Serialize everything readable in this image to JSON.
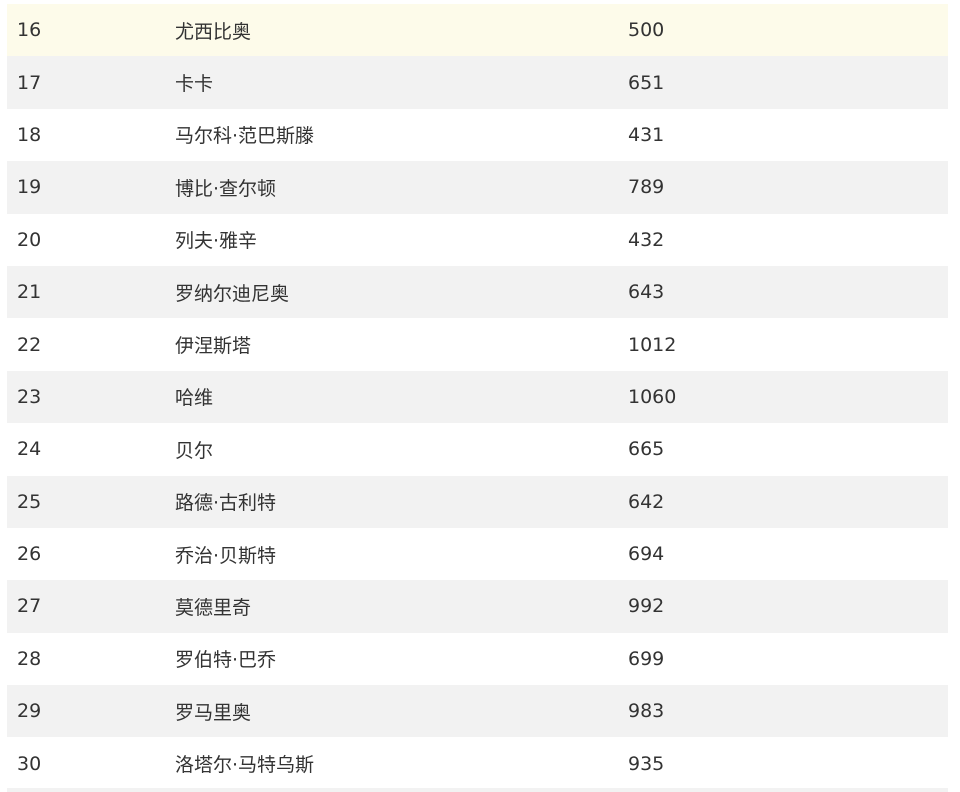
{
  "table": {
    "rows": [
      {
        "rank": "16",
        "name": "尤西比奥",
        "score": "500",
        "highlight": true
      },
      {
        "rank": "17",
        "name": "卡卡",
        "score": "651"
      },
      {
        "rank": "18",
        "name": "马尔科·范巴斯滕",
        "score": "431"
      },
      {
        "rank": "19",
        "name": "博比·查尔顿",
        "score": "789"
      },
      {
        "rank": "20",
        "name": "列夫·雅辛",
        "score": "432"
      },
      {
        "rank": "21",
        "name": "罗纳尔迪尼奥",
        "score": "643"
      },
      {
        "rank": "22",
        "name": "伊涅斯塔",
        "score": "1012"
      },
      {
        "rank": "23",
        "name": "哈维",
        "score": "1060"
      },
      {
        "rank": "24",
        "name": "贝尔",
        "score": "665"
      },
      {
        "rank": "25",
        "name": "路德·古利特",
        "score": "642"
      },
      {
        "rank": "26",
        "name": "乔治·贝斯特",
        "score": "694"
      },
      {
        "rank": "27",
        "name": "莫德里奇",
        "score": "992"
      },
      {
        "rank": "28",
        "name": "罗伯特·巴乔",
        "score": "699"
      },
      {
        "rank": "29",
        "name": "罗马里奥",
        "score": "983"
      },
      {
        "rank": "30",
        "name": "洛塔尔·马特乌斯",
        "score": "935"
      }
    ]
  },
  "colors": {
    "highlight_row": "#fdfbea",
    "striped_row": "#f2f2f2",
    "text": "#333333"
  }
}
